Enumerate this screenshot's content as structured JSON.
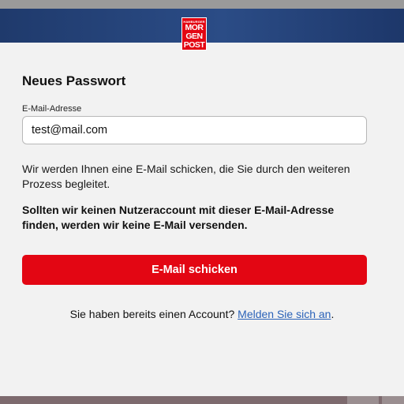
{
  "logo": {
    "line1": "HAMBURGER",
    "line2": "MOR",
    "line3": "GEN",
    "line4": "POST"
  },
  "form": {
    "title": "Neues Passwort",
    "email_label": "E-Mail-Adresse",
    "email_value": "test@mail.com",
    "info_text": "Wir werden Ihnen eine E-Mail schicken, die Sie durch den weiteren Prozess begleitet.",
    "notice_text": "Sollten wir keinen Nutzeraccount mit dieser E-Mail-Adresse finden, werden wir keine E-Mail versenden.",
    "submit_label": "E-Mail schicken"
  },
  "login": {
    "prompt": "Sie haben bereits einen Account?",
    "link_text": "Melden Sie sich an",
    "suffix": "."
  },
  "colors": {
    "header": "#243f73",
    "accent_red": "#e30613",
    "link_blue": "#2a62b8",
    "background": "#f2f2f2"
  }
}
